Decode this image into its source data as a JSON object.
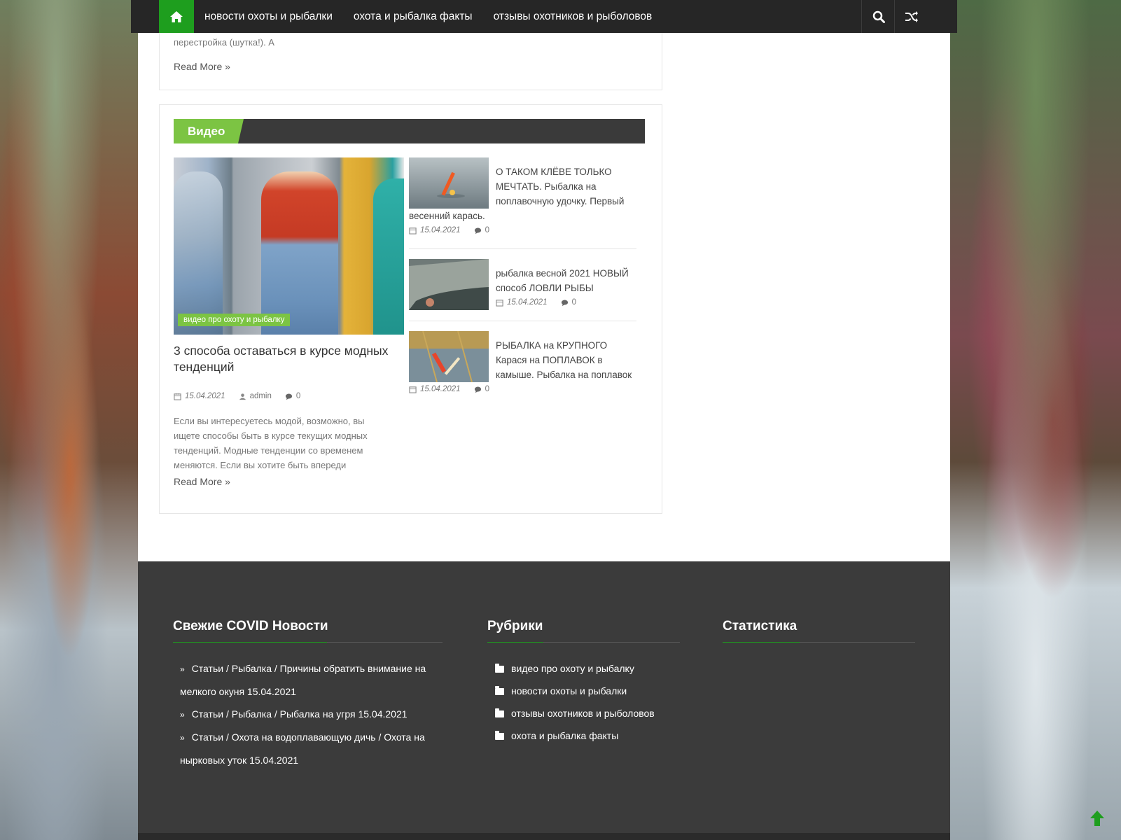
{
  "nav": {
    "items": [
      "новости охоты и рыбалки",
      "охота и рыбалка факты",
      "отзывы охотников и рыболовов"
    ],
    "home_icon": "home-icon",
    "search_icon": "search-icon",
    "random_icon": "shuffle-icon"
  },
  "prev_article": {
    "excerpt_tail": "перестройка (шутка!). А",
    "read_more": "Read More »"
  },
  "video_section": {
    "title": "Видео",
    "featured": {
      "category_badge": "видео про охоту и рыбалку",
      "title": "3 способа оставаться в курсе модных тенденций",
      "date": "15.04.2021",
      "author": "admin",
      "comments": "0",
      "excerpt": "Если вы интересуетесь модой, возможно, вы ищете способы быть в курсе текущих модных тенденций. Модные тенденции со временем меняются. Если вы хотите быть впереди",
      "read_more": "Read More »"
    },
    "side_posts": [
      {
        "title": "О ТАКОМ КЛЁВЕ ТОЛЬКО МЕЧТАТЬ. Рыбалка на поплавочную удочку. Первый весенний карась.",
        "date": "15.04.2021",
        "comments": "0"
      },
      {
        "title": "рыбалка весной 2021 НОВЫЙ способ ЛОВЛИ РЫБЫ",
        "date": "15.04.2021",
        "comments": "0"
      },
      {
        "title": "РЫБАЛКА на КРУПНОГО Карася на ПОПЛАВОК в камыше. Рыбалка на поплавок",
        "date": "15.04.2021",
        "comments": "0"
      }
    ]
  },
  "footer": {
    "col1": {
      "title": "Свежие COVID Новости",
      "items": [
        "Статьи / Рыбалка / Причины обратить внимание на мелкого окуня 15.04.2021",
        "Статьи / Рыбалка / Рыбалка на угря 15.04.2021",
        "Статьи / Охота на водоплавающую дичь / Охота на нырковых уток 15.04.2021"
      ]
    },
    "col2": {
      "title": "Рубрики",
      "items": [
        "видео про охоту и рыбалку",
        "новости охоты и рыбалки",
        "отзывы охотников и рыболовов",
        "охота и рыбалка факты"
      ]
    },
    "col3": {
      "title": "Статистика"
    }
  },
  "colors": {
    "accent_green": "#1e9e1e",
    "light_green": "#7cc443",
    "nav_bg": "#262626",
    "footer_bg": "#3b3b3b"
  }
}
